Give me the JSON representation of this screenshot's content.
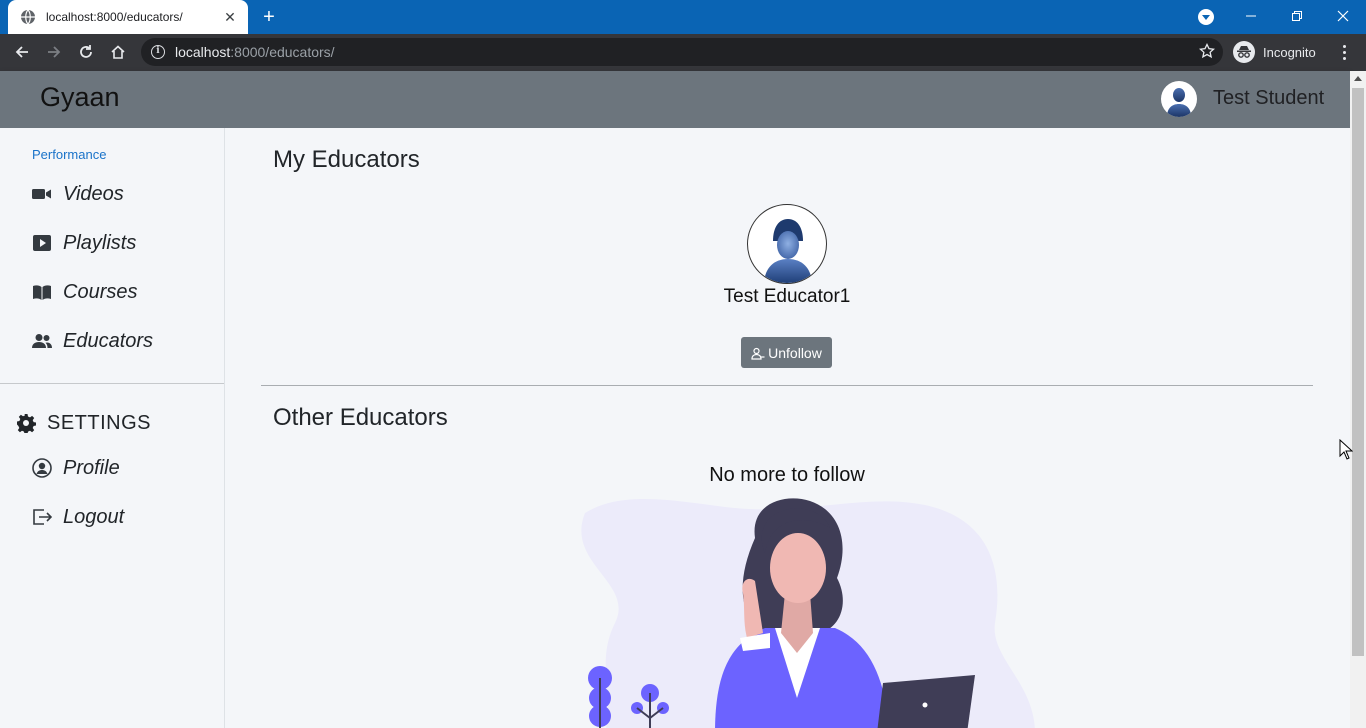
{
  "browser": {
    "tab_title": "localhost:8000/educators/",
    "new_tab_symbol": "+",
    "url_host": "localhost",
    "url_path": ":8000/educators/",
    "incognito_label": "Incognito",
    "icons": [
      "globe-icon",
      "close-icon",
      "new-tab-icon",
      "tab-search-icon",
      "minimize-icon",
      "maximize-icon",
      "window-close-icon",
      "back-icon",
      "forward-icon",
      "reload-icon",
      "home-icon",
      "site-info-icon",
      "bookmark-star-icon",
      "incognito-icon",
      "menu-icon"
    ]
  },
  "header": {
    "brand": "Gyaan",
    "user_name": "Test Student"
  },
  "sidebar": {
    "performance_label": "Performance",
    "items": [
      {
        "label": "Videos",
        "icon": "video-camera-icon"
      },
      {
        "label": "Playlists",
        "icon": "play-square-icon"
      },
      {
        "label": "Courses",
        "icon": "book-icon"
      },
      {
        "label": "Educators",
        "icon": "users-icon"
      }
    ],
    "settings": {
      "label": "SETTINGS",
      "icon": "gear-icon",
      "items": [
        {
          "label": "Profile",
          "icon": "user-circle-icon"
        },
        {
          "label": "Logout",
          "icon": "logout-icon"
        }
      ]
    }
  },
  "main": {
    "my_educators_title": "My Educators",
    "educators": [
      {
        "name": "Test Educator1",
        "action_label": "Unfollow"
      }
    ],
    "other_educators_title": "Other Educators",
    "empty_message": "No more to follow"
  },
  "colors": {
    "tabbar": "#0a64b4",
    "toolbar": "#35363a",
    "header": "#6c757d",
    "page_bg": "#f4f6f9",
    "link": "#1a73c9",
    "illustration_purple": "#6c63ff"
  }
}
